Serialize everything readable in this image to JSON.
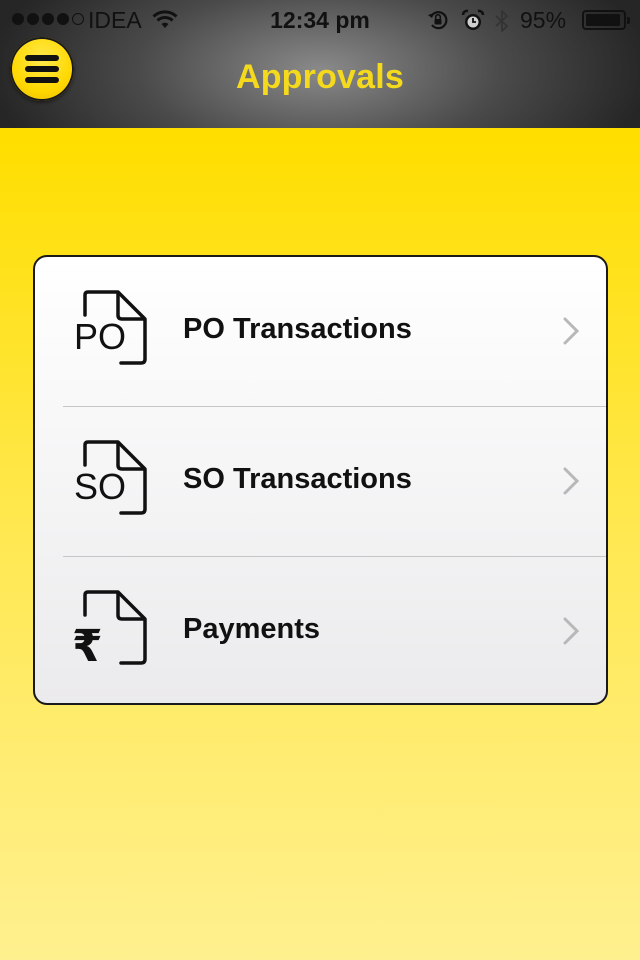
{
  "status_bar": {
    "carrier": "IDEA",
    "time": "12:34 pm",
    "battery_percent": "95%",
    "battery_level": 0.95,
    "signal_bars_filled": 4,
    "signal_bars_total": 5
  },
  "header": {
    "title": "Approvals",
    "menu_icon": "hamburger-menu-icon"
  },
  "menu": {
    "items": [
      {
        "label": "PO Transactions",
        "icon_text": "PO",
        "icon": "po-document-icon"
      },
      {
        "label": "SO Transactions",
        "icon_text": "SO",
        "icon": "so-document-icon"
      },
      {
        "label": "Payments",
        "icon_text": "₹",
        "icon": "rupee-document-icon"
      }
    ]
  },
  "colors": {
    "accent_yellow": "#FFDE00",
    "title_yellow": "#F4D91C",
    "header_dark": "#262626"
  }
}
